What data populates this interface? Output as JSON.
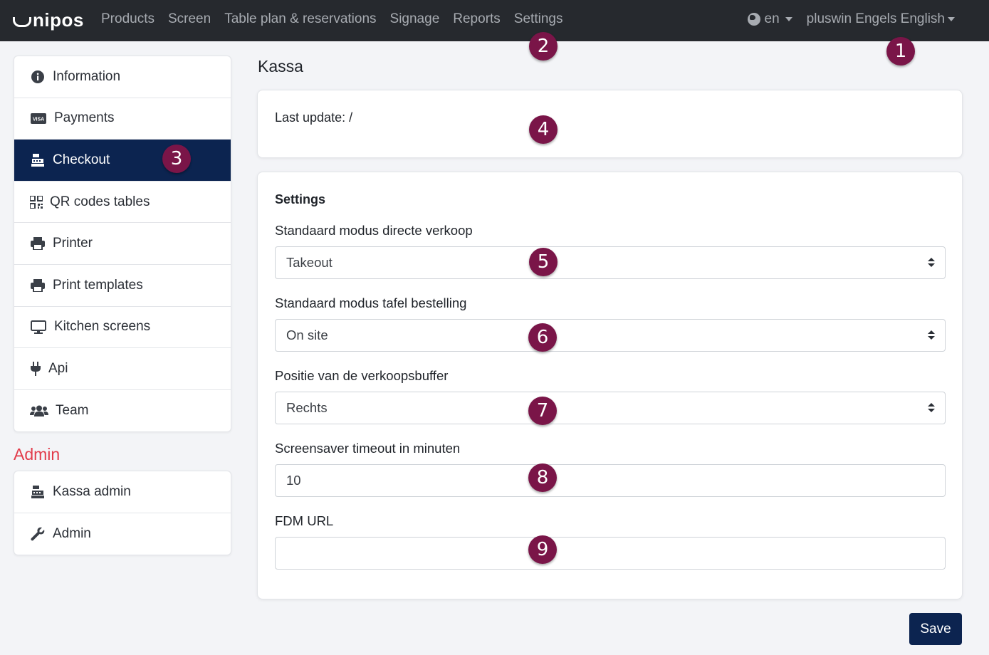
{
  "navbar": {
    "logo": "nipos",
    "links": [
      "Products",
      "Screen",
      "Table plan & reservations",
      "Signage",
      "Reports",
      "Settings"
    ],
    "language": "en",
    "user": "pluswin Engels English"
  },
  "sidebar": {
    "items": [
      {
        "label": "Information",
        "icon": "info-circle-icon"
      },
      {
        "label": "Payments",
        "icon": "visa-card-icon"
      },
      {
        "label": "Checkout",
        "icon": "cash-register-icon",
        "active": true
      },
      {
        "label": "QR codes tables",
        "icon": "qrcode-icon"
      },
      {
        "label": "Printer",
        "icon": "printer-icon"
      },
      {
        "label": "Print templates",
        "icon": "printer-icon"
      },
      {
        "label": "Kitchen screens",
        "icon": "monitor-icon"
      },
      {
        "label": "Api",
        "icon": "plug-icon"
      },
      {
        "label": "Team",
        "icon": "users-icon"
      }
    ],
    "admin_title": "Admin",
    "admin_items": [
      {
        "label": "Kassa admin",
        "icon": "cash-register-icon"
      },
      {
        "label": "Admin",
        "icon": "wrench-icon"
      }
    ]
  },
  "main": {
    "title": "Kassa",
    "last_update": "Last update: /",
    "settings_title": "Settings",
    "fields": [
      {
        "label": "Standaard modus directe verkoop",
        "type": "select",
        "value": "Takeout"
      },
      {
        "label": "Standaard modus tafel bestelling",
        "type": "select",
        "value": "On site"
      },
      {
        "label": "Positie van de verkoopsbuffer",
        "type": "select",
        "value": "Rechts"
      },
      {
        "label": "Screensaver timeout in minuten",
        "type": "input",
        "value": "10"
      },
      {
        "label": "FDM URL",
        "type": "input",
        "value": ""
      }
    ],
    "save_label": "Save"
  },
  "annotations": [
    "1",
    "2",
    "3",
    "4",
    "5",
    "6",
    "7",
    "8",
    "9"
  ],
  "colors": {
    "navbar_bg": "#26292e",
    "active_item": "#0c2450",
    "badge": "#7a1548",
    "admin_title": "#e23b4a",
    "save_button": "#0c2450"
  }
}
